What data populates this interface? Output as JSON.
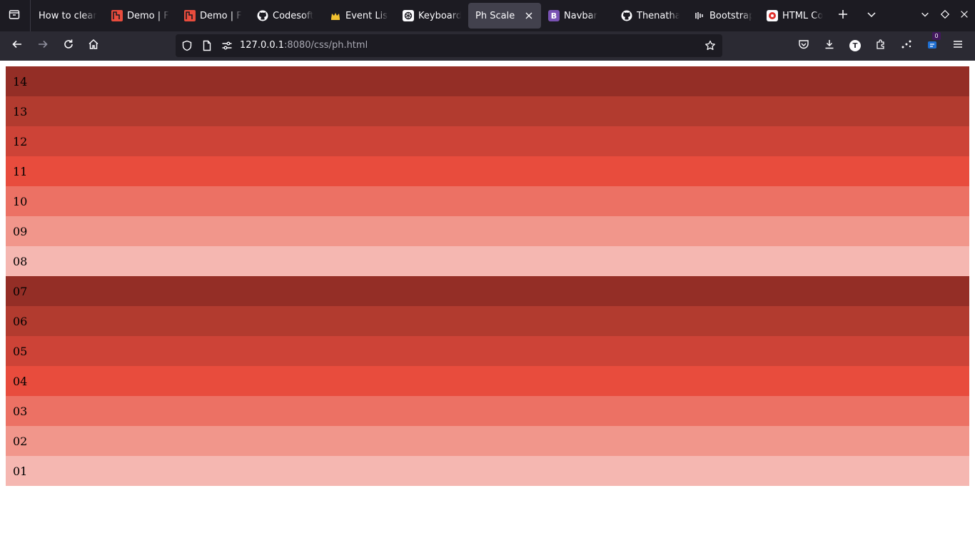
{
  "tabs": [
    {
      "label": "How to clean",
      "favicon": "none",
      "active": false
    },
    {
      "label": "Demo | F",
      "favicon": "red-square-logo",
      "active": false
    },
    {
      "label": "Demo | F",
      "favicon": "red-square-logo",
      "active": false
    },
    {
      "label": "Codesoft",
      "favicon": "github-logo",
      "active": false
    },
    {
      "label": "Event List",
      "favicon": "crown-logo",
      "active": false
    },
    {
      "label": "Keyboard",
      "favicon": "openai-logo",
      "active": false
    },
    {
      "label": "Ph Scale",
      "favicon": "none",
      "active": true
    },
    {
      "label": "Navbar",
      "favicon": "bootstrap-logo",
      "active": false
    },
    {
      "label": "Thenatha",
      "favicon": "github-logo",
      "active": false
    },
    {
      "label": "Bootstrap",
      "favicon": "bootstrap-icons-logo",
      "active": false
    },
    {
      "label": "HTML Co",
      "favicon": "html-color-logo",
      "active": false
    }
  ],
  "favicon_text": {
    "bootstrap": "B"
  },
  "address": {
    "host": "127.0.0.1",
    "rest": ":8080/css/ph.html"
  },
  "toolbar": {
    "extension_badge": "0",
    "account_initial": "T"
  },
  "ph_rows": [
    {
      "label": "14",
      "color": "#942e26"
    },
    {
      "label": "13",
      "color": "#b23b2f"
    },
    {
      "label": "12",
      "color": "#cd4337"
    },
    {
      "label": "11",
      "color": "#e84c3d"
    },
    {
      "label": "10",
      "color": "#ec7164"
    },
    {
      "label": "09",
      "color": "#f1968b"
    },
    {
      "label": "08",
      "color": "#f5b7b1"
    },
    {
      "label": "07",
      "color": "#942e26"
    },
    {
      "label": "06",
      "color": "#b23b2f"
    },
    {
      "label": "05",
      "color": "#cd4337"
    },
    {
      "label": "04",
      "color": "#e84c3d"
    },
    {
      "label": "03",
      "color": "#ec7164"
    },
    {
      "label": "02",
      "color": "#f1968b"
    },
    {
      "label": "01",
      "color": "#f5b7b1"
    }
  ]
}
